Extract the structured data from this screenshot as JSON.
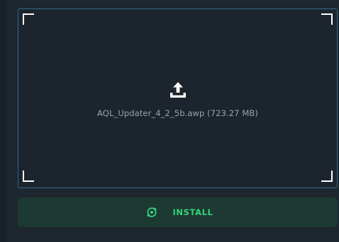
{
  "drop_zone": {
    "file_label": "AQL_Updater_4_2_5b.awp (723.27 MB)",
    "icon": "upload-icon"
  },
  "install_button": {
    "label": "INSTALL",
    "icon": "sync-install-icon"
  },
  "colors": {
    "background": "#1e262f",
    "drop_zone_border": "#2c6f8d",
    "accent_green": "#34d47e",
    "button_background": "#1d3a32"
  }
}
